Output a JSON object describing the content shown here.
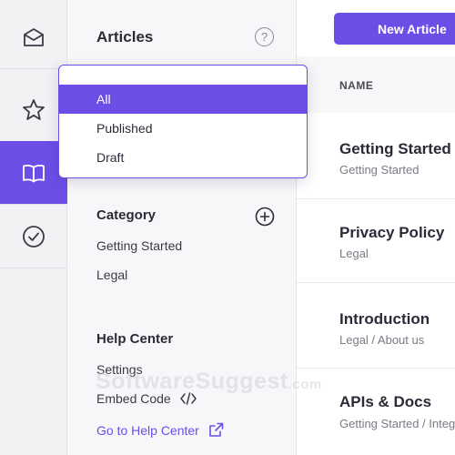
{
  "rail": {
    "items": [
      {
        "icon": "inbox-icon"
      },
      {
        "icon": "star-icon"
      },
      {
        "icon": "book-icon",
        "active": true
      },
      {
        "icon": "check-circle-icon"
      }
    ]
  },
  "panel": {
    "title": "Articles",
    "help_icon": "?",
    "dropdown": {
      "options": [
        "All",
        "Published",
        "Draft"
      ],
      "selected": "All"
    },
    "category": {
      "title": "Category",
      "items": [
        "Getting Started",
        "Legal"
      ]
    },
    "help_center": {
      "title": "Help Center",
      "items": [
        "Settings",
        "Embed Code"
      ],
      "link": "Go to Help Center"
    }
  },
  "main": {
    "new_article_label": "New Article",
    "column_header": "NAME",
    "rows": [
      {
        "title": "Getting Started",
        "subtitle": "Getting Started"
      },
      {
        "title": "Privacy Policy",
        "subtitle": "Legal"
      },
      {
        "title": "Introduction",
        "subtitle": "Legal / About us"
      },
      {
        "title": "APIs & Docs",
        "subtitle": "Getting Started / Integ"
      }
    ]
  },
  "colors": {
    "accent": "#6c4ee6",
    "rail_bg": "#f2f2f5",
    "panel_bg": "#f7f7f9"
  },
  "watermark": {
    "text": "SoftwareSuggest",
    "suffix": ".com"
  }
}
